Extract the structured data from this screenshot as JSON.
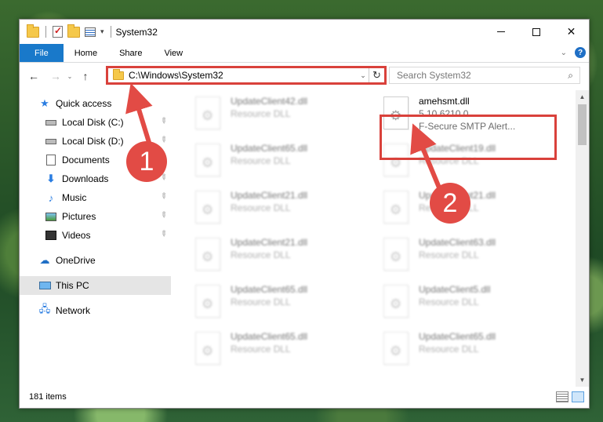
{
  "window": {
    "title": "System32",
    "controls": {
      "minimize": "—",
      "maximize": "□",
      "close": "✕"
    }
  },
  "ribbon": {
    "tabs": [
      "File",
      "Home",
      "Share",
      "View"
    ],
    "expand_icon": "chevron-down-icon",
    "help_label": "?"
  },
  "nav": {
    "back": "←",
    "forward": "→",
    "recent": "⌄",
    "up": "↑"
  },
  "address": {
    "path": "C:\\Windows\\System32",
    "dropdown": "⌄",
    "refresh": "↻"
  },
  "search": {
    "placeholder": "Search System32",
    "icon": "⌕"
  },
  "sidebar": {
    "items": [
      {
        "label": "Quick access",
        "icon": "star-icon"
      },
      {
        "label": "Local Disk (C:)",
        "icon": "disk-icon",
        "pinned": true
      },
      {
        "label": "Local Disk (D:)",
        "icon": "disk-icon",
        "pinned": true
      },
      {
        "label": "Documents",
        "icon": "documents-icon",
        "pinned": true
      },
      {
        "label": "Downloads",
        "icon": "downloads-icon",
        "pinned": true
      },
      {
        "label": "Music",
        "icon": "music-icon",
        "pinned": true
      },
      {
        "label": "Pictures",
        "icon": "pictures-icon",
        "pinned": true
      },
      {
        "label": "Videos",
        "icon": "videos-icon",
        "pinned": true
      },
      {
        "label": "OneDrive",
        "icon": "onedrive-icon"
      },
      {
        "label": "This PC",
        "icon": "this-pc-icon",
        "selected": true
      },
      {
        "label": "Network",
        "icon": "network-icon"
      }
    ],
    "pin_glyph": "📌"
  },
  "files": [
    {
      "name": "UpdateClient42.dll",
      "line1": "Resource DLL",
      "line2": "",
      "blurred": true
    },
    {
      "name": "amehsmt.dll",
      "line1": "5.10.6210.0",
      "line2": "F-Secure SMTP Alert...",
      "blurred": false
    },
    {
      "name": "UpdateClient65.dll",
      "line1": "Resource DLL",
      "line2": "",
      "blurred": true
    },
    {
      "name": "UpdateClient19.dll",
      "line1": "Resource DLL",
      "line2": "",
      "blurred": true
    },
    {
      "name": "UpdateClient21.dll",
      "line1": "Resource DLL",
      "line2": "",
      "blurred": true
    },
    {
      "name": "UpdateClient21.dll",
      "line1": "Resource DLL",
      "line2": "",
      "blurred": true
    },
    {
      "name": "UpdateClient21.dll",
      "line1": "Resource DLL",
      "line2": "",
      "blurred": true
    },
    {
      "name": "UpdateClient63.dll",
      "line1": "Resource DLL",
      "line2": "",
      "blurred": true
    },
    {
      "name": "UpdateClient65.dll",
      "line1": "Resource DLL",
      "line2": "",
      "blurred": true
    },
    {
      "name": "UpdateClient5.dll",
      "line1": "Resource DLL",
      "line2": "",
      "blurred": true
    },
    {
      "name": "UpdateClient65.dll",
      "line1": "Resource DLL",
      "line2": "",
      "blurred": true
    },
    {
      "name": "UpdateClient65.dll",
      "line1": "Resource DLL",
      "line2": "",
      "blurred": true
    }
  ],
  "status": {
    "item_count": "181 items"
  },
  "annotations": [
    {
      "label": "1"
    },
    {
      "label": "2"
    }
  ],
  "colors": {
    "accent": "#1979ca",
    "annotation": "#e24b45",
    "selection": "#cce8ff"
  }
}
